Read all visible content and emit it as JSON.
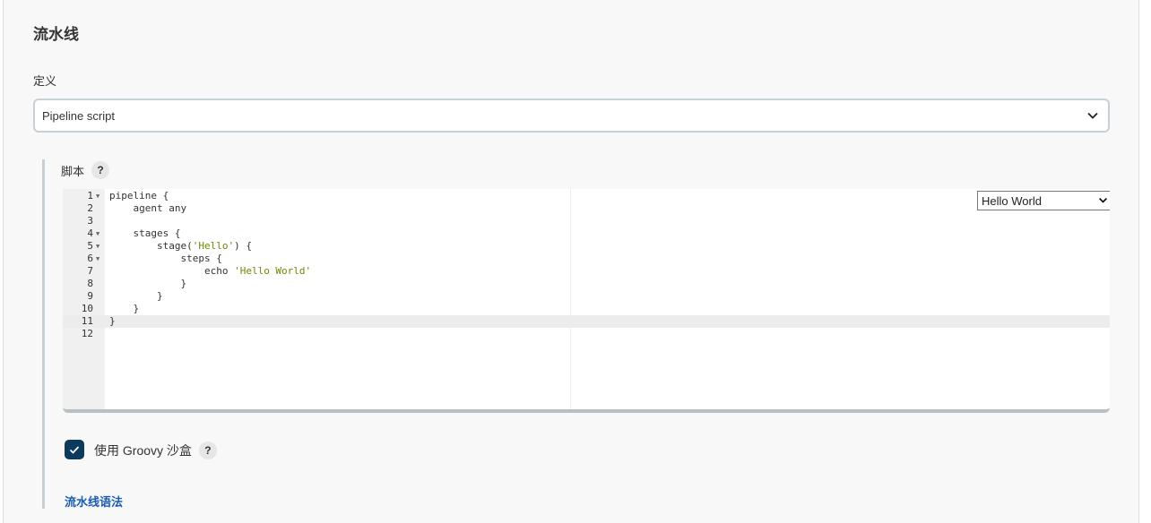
{
  "section_title": "流水线",
  "definition": {
    "label": "定义",
    "selected": "Pipeline script"
  },
  "script": {
    "label": "脚本",
    "help": "?",
    "sample_select": "Hello World",
    "active_line": 11,
    "lines": [
      {
        "n": "1",
        "fold": true,
        "parts": [
          {
            "t": "pipeline {"
          }
        ]
      },
      {
        "n": "2",
        "parts": [
          {
            "t": "    agent any"
          }
        ]
      },
      {
        "n": "3",
        "parts": [
          {
            "t": ""
          }
        ]
      },
      {
        "n": "4",
        "fold": true,
        "parts": [
          {
            "t": "    stages {"
          }
        ]
      },
      {
        "n": "5",
        "fold": true,
        "parts": [
          {
            "t": "        stage("
          },
          {
            "t": "'Hello'",
            "s": true
          },
          {
            "t": ") {"
          }
        ]
      },
      {
        "n": "6",
        "fold": true,
        "parts": [
          {
            "t": "            steps {"
          }
        ]
      },
      {
        "n": "7",
        "parts": [
          {
            "t": "                echo "
          },
          {
            "t": "'Hello World'",
            "s": true
          }
        ]
      },
      {
        "n": "8",
        "parts": [
          {
            "t": "            }"
          }
        ]
      },
      {
        "n": "9",
        "parts": [
          {
            "t": "        }"
          }
        ]
      },
      {
        "n": "10",
        "parts": [
          {
            "t": "    }"
          }
        ]
      },
      {
        "n": "11",
        "parts": [
          {
            "t": "}"
          }
        ]
      },
      {
        "n": "12",
        "parts": [
          {
            "t": ""
          }
        ]
      }
    ]
  },
  "sandbox": {
    "label": "使用 Groovy 沙盒",
    "checked": true,
    "help": "?"
  },
  "syntax_link": "流水线语法",
  "colors": {
    "checkbox": "#0b3a5c",
    "link": "#1a5bb5",
    "string": "#6a8a00"
  }
}
